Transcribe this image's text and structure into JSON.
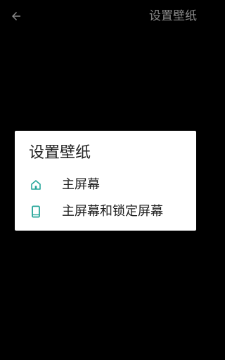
{
  "app": {
    "title": "设置壁纸"
  },
  "topbar": {
    "back_icon": "arrow-left-icon",
    "title": "设置壁纸"
  },
  "dialog": {
    "title": "设置壁纸",
    "options": [
      {
        "label": "主屏幕",
        "icon": "home-icon"
      },
      {
        "label": "主屏幕和锁定屏幕",
        "icon": "phone-icon"
      }
    ]
  },
  "colors": {
    "background": "#000000",
    "dialog_background": "#ffffff",
    "accent": "#26a69a",
    "topbar_text": "#8a8a8a",
    "text": "#212121"
  }
}
